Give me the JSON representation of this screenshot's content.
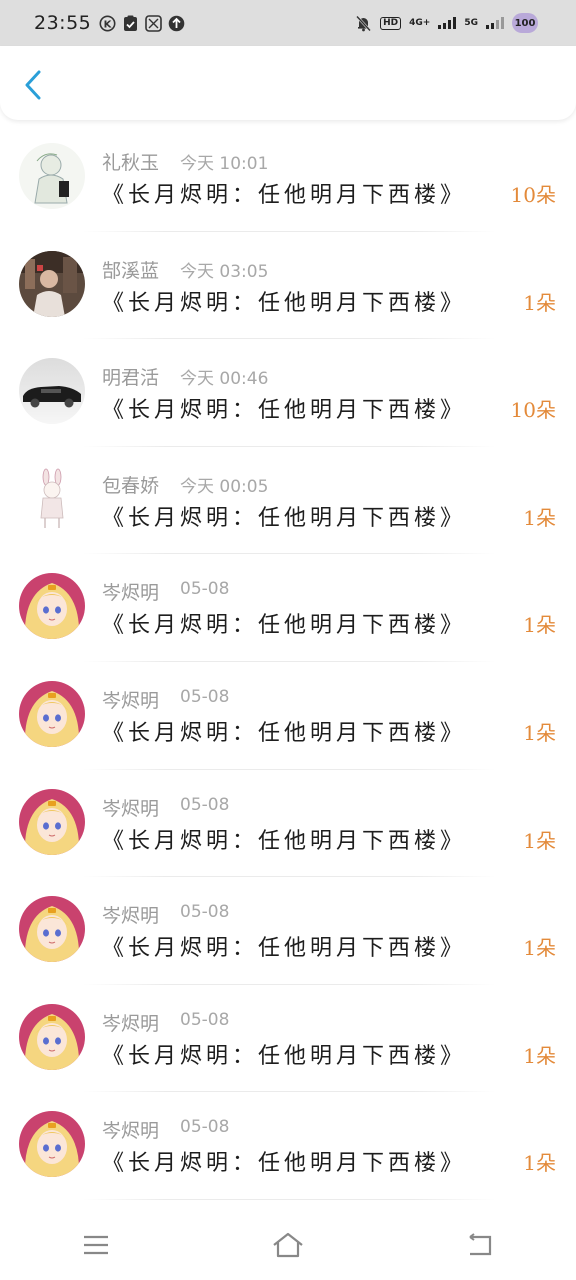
{
  "status_bar": {
    "time": "23:55",
    "hd_label": "HD",
    "net1": "4G+",
    "net2": "5G",
    "battery": "100"
  },
  "list": [
    {
      "sender": "礼秋玉",
      "time": "今天 10:01",
      "title": "《长月烬明：任他明月下西楼》",
      "count": "10朵",
      "avatar": "sketch-figure-avatar"
    },
    {
      "sender": "郜溪蓝",
      "time": "今天 03:05",
      "title": "《长月烬明：任他明月下西楼》",
      "count": "1朵",
      "avatar": "photo-person-avatar"
    },
    {
      "sender": "明君活",
      "time": "今天 00:46",
      "title": "《长月烬明：任他明月下西楼》",
      "count": "10朵",
      "avatar": "car-avatar"
    },
    {
      "sender": "包春娇",
      "time": "今天 00:05",
      "title": "《长月烬明：任他明月下西楼》",
      "count": "1朵",
      "avatar": "rabbit-avatar"
    },
    {
      "sender": "岑烬明",
      "time": "05-08",
      "title": "《长月烬明：任他明月下西楼》",
      "count": "1朵",
      "avatar": "anime-girl-avatar"
    },
    {
      "sender": "岑烬明",
      "time": "05-08",
      "title": "《长月烬明：任他明月下西楼》",
      "count": "1朵",
      "avatar": "anime-girl-avatar"
    },
    {
      "sender": "岑烬明",
      "time": "05-08",
      "title": "《长月烬明：任他明月下西楼》",
      "count": "1朵",
      "avatar": "anime-girl-avatar"
    },
    {
      "sender": "岑烬明",
      "time": "05-08",
      "title": "《长月烬明：任他明月下西楼》",
      "count": "1朵",
      "avatar": "anime-girl-avatar"
    },
    {
      "sender": "岑烬明",
      "time": "05-08",
      "title": "《长月烬明：任他明月下西楼》",
      "count": "1朵",
      "avatar": "anime-girl-avatar"
    },
    {
      "sender": "岑烬明",
      "time": "05-08",
      "title": "《长月烬明：任他明月下西楼》",
      "count": "1朵",
      "avatar": "anime-girl-avatar"
    }
  ],
  "colors": {
    "accent": "#2a9fd8",
    "count": "#e38a3a"
  }
}
